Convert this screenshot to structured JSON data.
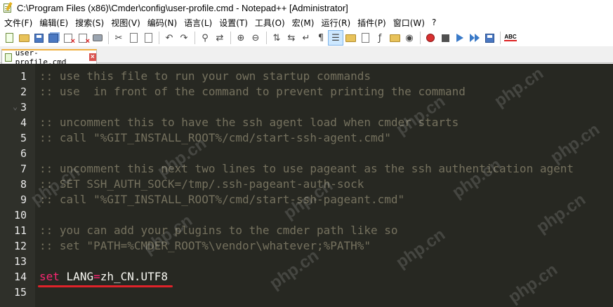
{
  "window": {
    "title": "C:\\Program Files (x86)\\Cmder\\config\\user-profile.cmd - Notepad++ [Administrator]"
  },
  "menu": [
    {
      "label": "文件(F)"
    },
    {
      "label": "编辑(E)"
    },
    {
      "label": "搜索(S)"
    },
    {
      "label": "视图(V)"
    },
    {
      "label": "编码(N)"
    },
    {
      "label": "语言(L)"
    },
    {
      "label": "设置(T)"
    },
    {
      "label": "工具(O)"
    },
    {
      "label": "宏(M)"
    },
    {
      "label": "运行(R)"
    },
    {
      "label": "插件(P)"
    },
    {
      "label": "窗口(W)"
    },
    {
      "label": "?"
    }
  ],
  "toolbar": {
    "spellcheck_label": "ABC"
  },
  "tabs": [
    {
      "label": "user-profile.cmd"
    }
  ],
  "editor": {
    "line_numbers": [
      "1",
      "2",
      "3",
      "4",
      "5",
      "6",
      "7",
      "8",
      "9",
      "10",
      "11",
      "12",
      "13",
      "14",
      "15"
    ],
    "lines": [
      {
        "text": ":: use this file to run your own startup commands"
      },
      {
        "text": ":: use  in front of the command to prevent printing the command"
      },
      {
        "text": ""
      },
      {
        "text": ":: uncomment this to have the ssh agent load when cmder starts"
      },
      {
        "text": ":: call \"%GIT_INSTALL_ROOT%/cmd/start-ssh-agent.cmd\""
      },
      {
        "text": ""
      },
      {
        "text": ":: uncomment this next two lines to use pageant as the ssh authentication agent"
      },
      {
        "text": ":: SET SSH_AUTH_SOCK=/tmp/.ssh-pageant-auth-sock"
      },
      {
        "text": ":: call \"%GIT_INSTALL_ROOT%/cmd/start-ssh-pageant.cmd\""
      },
      {
        "text": ""
      },
      {
        "text": ":: you can add your plugins to the cmder path like so"
      },
      {
        "text": ":: set \"PATH=%CMDER_ROOT%\\vendor\\whatever;%PATH%\""
      },
      {
        "text": ""
      },
      {
        "keyword": "set",
        "space": " ",
        "var": "LANG",
        "op": "=",
        "value": "zh_CN.UTF8"
      },
      {
        "text": ""
      }
    ]
  },
  "watermark": {
    "text": "php.cn"
  },
  "colors": {
    "editor_bg": "#272822",
    "comment": "#75715e",
    "keyword": "#f92672",
    "text": "#f8f8f2",
    "highlight_underline": "#e0232a",
    "tab_accent": "#f0b040"
  }
}
